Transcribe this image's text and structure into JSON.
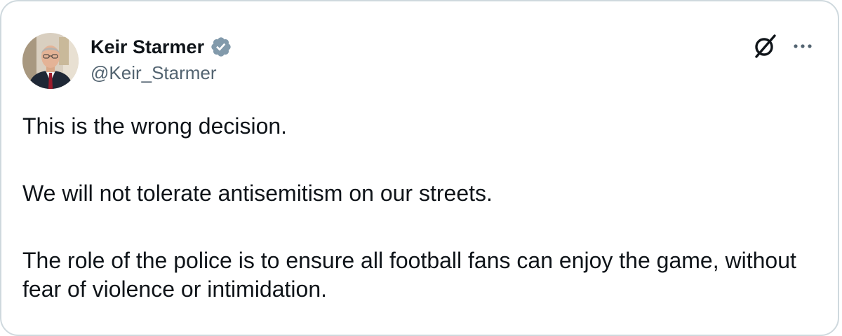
{
  "author": {
    "name": "Keir Starmer",
    "handle": "@Keir_Starmer",
    "verified": true
  },
  "tweet": {
    "paragraphs": [
      "This is the wrong decision.",
      "We will not tolerate antisemitism on our streets.",
      "The role of the police is to ensure all football fans can enjoy the game, without fear of violence or intimidation."
    ]
  },
  "icons": {
    "verified": "verified-badge-icon",
    "logo": "grok-logo-icon",
    "more": "more-options-icon"
  },
  "colors": {
    "text": "#0f1419",
    "secondary_text": "#536471",
    "border": "#cfd9de",
    "verified_badge": "#829aab"
  }
}
